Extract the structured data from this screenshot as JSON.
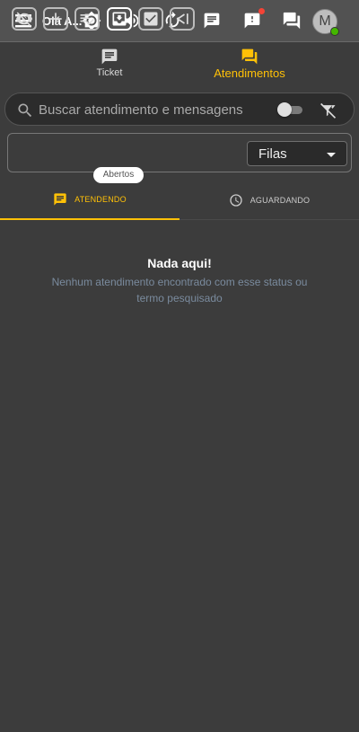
{
  "header": {
    "greeting": "Olá A...",
    "menu_icon": "menu-icon",
    "avatar_initial": "M",
    "colors": {
      "background": "#525252",
      "notification": "#f44336",
      "online": "#44b700"
    }
  },
  "main_tabs": [
    {
      "label": "Ticket",
      "icon": "chat-bubble-icon",
      "active": false
    },
    {
      "label": "Atendimentos",
      "icon": "forum-icon",
      "active": true
    }
  ],
  "search": {
    "placeholder": "Buscar atendimento e mensagens",
    "value": ""
  },
  "toolbar": {
    "tooltip": "Abertos",
    "queue_select": {
      "selected": "Filas"
    }
  },
  "sub_tabs": [
    {
      "label": "ATENDENDO",
      "icon": "message-icon",
      "active": true
    },
    {
      "label": "AGUARDANDO",
      "icon": "clock-icon",
      "active": false
    }
  ],
  "empty_state": {
    "title": "Nada aqui!",
    "message": "Nenhum atendimento encontrado com esse status ou termo pesquisado"
  },
  "accent_color": "#ffc107"
}
